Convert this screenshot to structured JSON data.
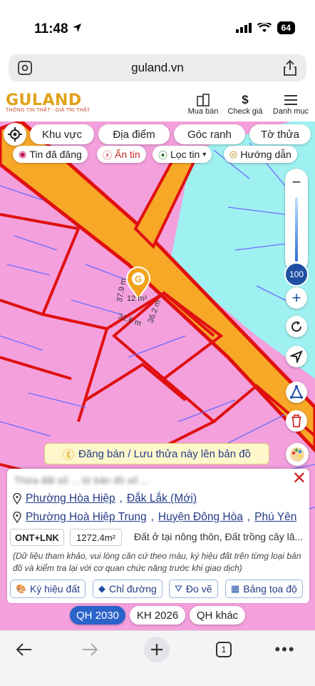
{
  "status": {
    "time": "11:48",
    "battery": "64"
  },
  "browser": {
    "url": "guland.vn",
    "tab_count": "1"
  },
  "header": {
    "logo": "GULAND",
    "tagline": "THÔNG TIN THẬT - GIÁ TRỊ THẬT",
    "items": [
      {
        "label": "Mua bán",
        "icon": "building-icon"
      },
      {
        "label": "Check giá",
        "icon": "dollar-icon"
      },
      {
        "label": "Danh mục",
        "icon": "hamburger-icon"
      }
    ]
  },
  "map": {
    "nav_pills": [
      "Khu vực",
      "Địa điểm",
      "Góc ranh",
      "Tờ thửa"
    ],
    "chips": [
      {
        "label": "Tin đã đăng",
        "icon": "listing-icon"
      },
      {
        "label": "Ẩn tin",
        "icon": "close-circle-icon"
      },
      {
        "label": "Lọc tin",
        "icon": "pin-icon"
      },
      {
        "label": "Hướng dẫn",
        "icon": "target-icon"
      }
    ],
    "zoom_level": "100",
    "dimensions": [
      "37.9 m",
      "31.6 m",
      "36.2 m"
    ],
    "area_label": "12 m²",
    "post_banner": "Đăng bán / Lưu thửa này lên bản đồ",
    "colors": {
      "residential": "#f3a0dd",
      "road": "#f7a826",
      "water_land": "#9ff0f0",
      "boundary": "#e01010"
    }
  },
  "panel": {
    "title": "Thửa đất số ... tờ bản đồ số ...",
    "address_new": [
      "Phường Hòa Hiệp",
      "Đắk Lắk (Mới)"
    ],
    "address_old": [
      "Phường Hoà Hiệp Trung",
      "Huyện Đông Hòa",
      "Phú Yên"
    ],
    "land_type": "ONT+LNK",
    "area": "1272.4m²",
    "description": "Đất ở tại nông thôn, Đất trồng cây lâ...",
    "note": "(Dữ liệu tham khảo, vui lòng căn cứ theo màu, ký hiệu đất trên từng loại bản đồ và kiểm tra lại với cơ quan chức năng trước khi giao dịch)",
    "tools": [
      {
        "label": "Ký hiệu đất",
        "icon": "palette-icon"
      },
      {
        "label": "Chỉ đường",
        "icon": "directions-icon"
      },
      {
        "label": "Đo vẽ",
        "icon": "measure-icon"
      },
      {
        "label": "Bảng tọa độ",
        "icon": "table-icon"
      }
    ]
  },
  "plans": [
    {
      "label": "QH 2030",
      "active": true
    },
    {
      "label": "KH 2026",
      "active": false
    },
    {
      "label": "QH khác",
      "active": false
    }
  ]
}
